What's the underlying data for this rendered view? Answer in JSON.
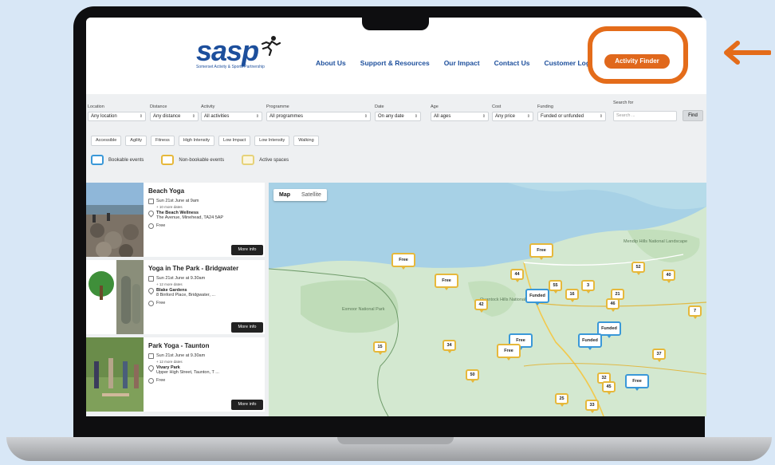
{
  "header": {
    "logo_text": "sasp",
    "logo_subtitle": "Somerset Activity & Sports Partnership",
    "nav": [
      "About Us",
      "Support & Resources",
      "Our Impact",
      "Contact Us",
      "Customer Log"
    ],
    "cta": "Activity Finder"
  },
  "filters": {
    "fields": [
      {
        "label": "Location",
        "value": "Any location"
      },
      {
        "label": "Distance",
        "value": "Any distance"
      },
      {
        "label": "Activity",
        "value": "All activities"
      },
      {
        "label": "Programme",
        "value": "All programmes"
      },
      {
        "label": "Date",
        "value": "On any date"
      },
      {
        "label": "Age",
        "value": "All ages"
      },
      {
        "label": "Cost",
        "value": "Any price"
      },
      {
        "label": "Funding",
        "value": "Funded or unfunded"
      }
    ],
    "search_label": "Search for",
    "search_placeholder": "Search ...",
    "find": "Find",
    "chips": [
      "Accessible",
      "Agility",
      "Fitness",
      "High Intensity",
      "Low Impact",
      "Low Intensity",
      "Walking"
    ],
    "legend": [
      {
        "label": "Bookable events",
        "color": "#3a98d8"
      },
      {
        "label": "Non-bookable events",
        "color": "#e6b83b"
      },
      {
        "label": "Active spaces",
        "color": "#e6d27a"
      }
    ]
  },
  "events": [
    {
      "title": "Beach Yoga",
      "date": "Sun 21st June at 9am",
      "more_dates": "+ 10 more dates",
      "venue": "The Beach Wellness",
      "address": "The Avenue, Minehead, TA24 5AP",
      "price": "Free",
      "button": "More info"
    },
    {
      "title": "Yoga in The Park - Bridgwater",
      "date": "Sun 21st June at 9.30am",
      "more_dates": "+ 12 more dates",
      "venue": "Blake Gardens",
      "address": "8 Binford Place, Bridgwater, ...",
      "price": "Free",
      "button": "More info"
    },
    {
      "title": "Park Yoga - Taunton",
      "date": "Sun 21st June at 9.30am",
      "more_dates": "+ 12 more dates",
      "venue": "Vivary Park",
      "address": "Upper High Street, Taunton, T ...",
      "price": "Free",
      "button": "More info"
    }
  ],
  "map": {
    "tabs": [
      "Map",
      "Satellite"
    ],
    "place_labels": [
      "Exmoor National Park",
      "Quantock Hills National Landscape",
      "Mendip Hills National Landscape"
    ],
    "markers": [
      {
        "label": "Free",
        "type": "gold"
      },
      {
        "label": "Free",
        "type": "gold"
      },
      {
        "label": "Free",
        "type": "gold"
      },
      {
        "label": "44",
        "type": "gold"
      },
      {
        "label": "55",
        "type": "gold"
      },
      {
        "label": "3",
        "type": "gold"
      },
      {
        "label": "16",
        "type": "gold"
      },
      {
        "label": "Funded",
        "type": "blue"
      },
      {
        "label": "21",
        "type": "gold"
      },
      {
        "label": "46",
        "type": "gold"
      },
      {
        "label": "52",
        "type": "gold"
      },
      {
        "label": "40",
        "type": "gold"
      },
      {
        "label": "42",
        "type": "gold"
      },
      {
        "label": "7",
        "type": "gold"
      },
      {
        "label": "Funded",
        "type": "blue"
      },
      {
        "label": "Funded",
        "type": "blue"
      },
      {
        "label": "Free",
        "type": "blue"
      },
      {
        "label": "Free",
        "type": "gold"
      },
      {
        "label": "15",
        "type": "gold"
      },
      {
        "label": "34",
        "type": "gold"
      },
      {
        "label": "37",
        "type": "gold"
      },
      {
        "label": "50",
        "type": "gold"
      },
      {
        "label": "32",
        "type": "gold"
      },
      {
        "label": "45",
        "type": "gold"
      },
      {
        "label": "Free",
        "type": "blue"
      },
      {
        "label": "25",
        "type": "gold"
      },
      {
        "label": "33",
        "type": "gold"
      }
    ]
  },
  "colors": {
    "brand_blue": "#1d4f9c",
    "accent_orange": "#e0681c",
    "annotation_orange": "#e46c1a",
    "sea": "#a7d1e6",
    "land": "#d3e8d0"
  }
}
